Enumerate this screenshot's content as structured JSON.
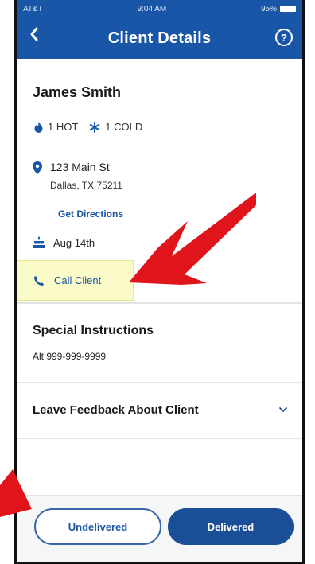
{
  "status_bar": {
    "carrier": "AT&T",
    "time": "9:04 AM",
    "battery": "95%"
  },
  "header": {
    "title": "Client Details",
    "back_icon": "chevron-left-icon",
    "help_icon": "question-circle-icon",
    "help_glyph": "?"
  },
  "client": {
    "name": "James Smith",
    "hot_count": "1 HOT",
    "cold_count": "1 COLD",
    "address_line1": "123 Main St",
    "address_line2": "Dallas, TX 75211",
    "directions_label": "Get Directions",
    "birthday": "Aug 14th",
    "call_label": "Call Client"
  },
  "special_instructions": {
    "title": "Special Instructions",
    "text": "Alt 999-999-9999"
  },
  "feedback": {
    "label": "Leave Feedback About Client"
  },
  "actions": {
    "undelivered_label": "Undelivered",
    "delivered_label": "Delivered"
  },
  "colors": {
    "brand_blue": "#1a56a8",
    "highlight_yellow": "#fafbc8",
    "annotation_red": "#e0141b"
  }
}
